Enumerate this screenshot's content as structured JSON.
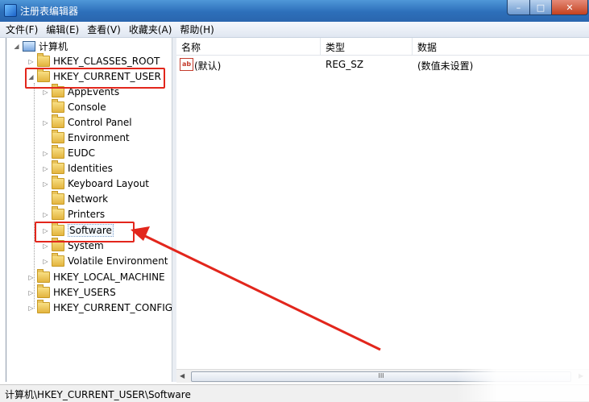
{
  "window": {
    "title": "注册表编辑器",
    "minimize": "–",
    "maximize": "□",
    "close": "✕"
  },
  "menu": [
    "文件(F)",
    "编辑(E)",
    "查看(V)",
    "收藏夹(A)",
    "帮助(H)"
  ],
  "tree": {
    "root": "计算机",
    "hives": [
      "HKEY_CLASSES_ROOT",
      "HKEY_CURRENT_USER",
      "HKEY_LOCAL_MACHINE",
      "HKEY_USERS",
      "HKEY_CURRENT_CONFIG"
    ],
    "hkcu_children": [
      "AppEvents",
      "Console",
      "Control Panel",
      "Environment",
      "EUDC",
      "Identities",
      "Keyboard Layout",
      "Network",
      "Printers",
      "Software",
      "System",
      "Volatile Environment"
    ],
    "selected": "Software"
  },
  "list": {
    "columns": [
      "名称",
      "类型",
      "数据"
    ],
    "rows": [
      {
        "name": "(默认)",
        "type": "REG_SZ",
        "data": "(数值未设置)",
        "icon": "ab-string-icon"
      }
    ],
    "icon_text": "ab"
  },
  "scrollbar": {
    "thumb_grip": "III",
    "left": "◀",
    "right": "▶"
  },
  "status": {
    "path": "计算机\\HKEY_CURRENT_USER\\Software"
  },
  "colors": {
    "annotation": "#e2261c",
    "title_bar": "#2d6fba"
  }
}
